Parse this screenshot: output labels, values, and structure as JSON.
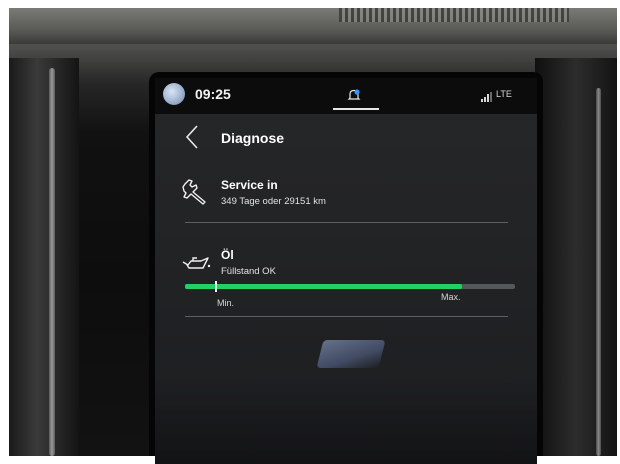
{
  "status_bar": {
    "time": "09:25",
    "network": "LTE"
  },
  "header": {
    "title": "Diagnose"
  },
  "service": {
    "title": "Service in",
    "detail": "349 Tage oder 29151 km"
  },
  "oil": {
    "title": "Öl",
    "status": "Füllstand OK",
    "level_fraction": 0.84,
    "min_tick_fraction": 0.09,
    "min_label": "Min.",
    "max_label": "Max."
  },
  "colors": {
    "accent_green": "#22d166",
    "notification_blue": "#2f95ff",
    "screen_background": "#242527"
  },
  "icons": {
    "avatar": "user-avatar-icon",
    "notification": "bell-icon",
    "signal": "signal-strength-icon",
    "back": "chevron-left-icon",
    "service": "wrench-icon",
    "oil": "oil-can-icon"
  }
}
